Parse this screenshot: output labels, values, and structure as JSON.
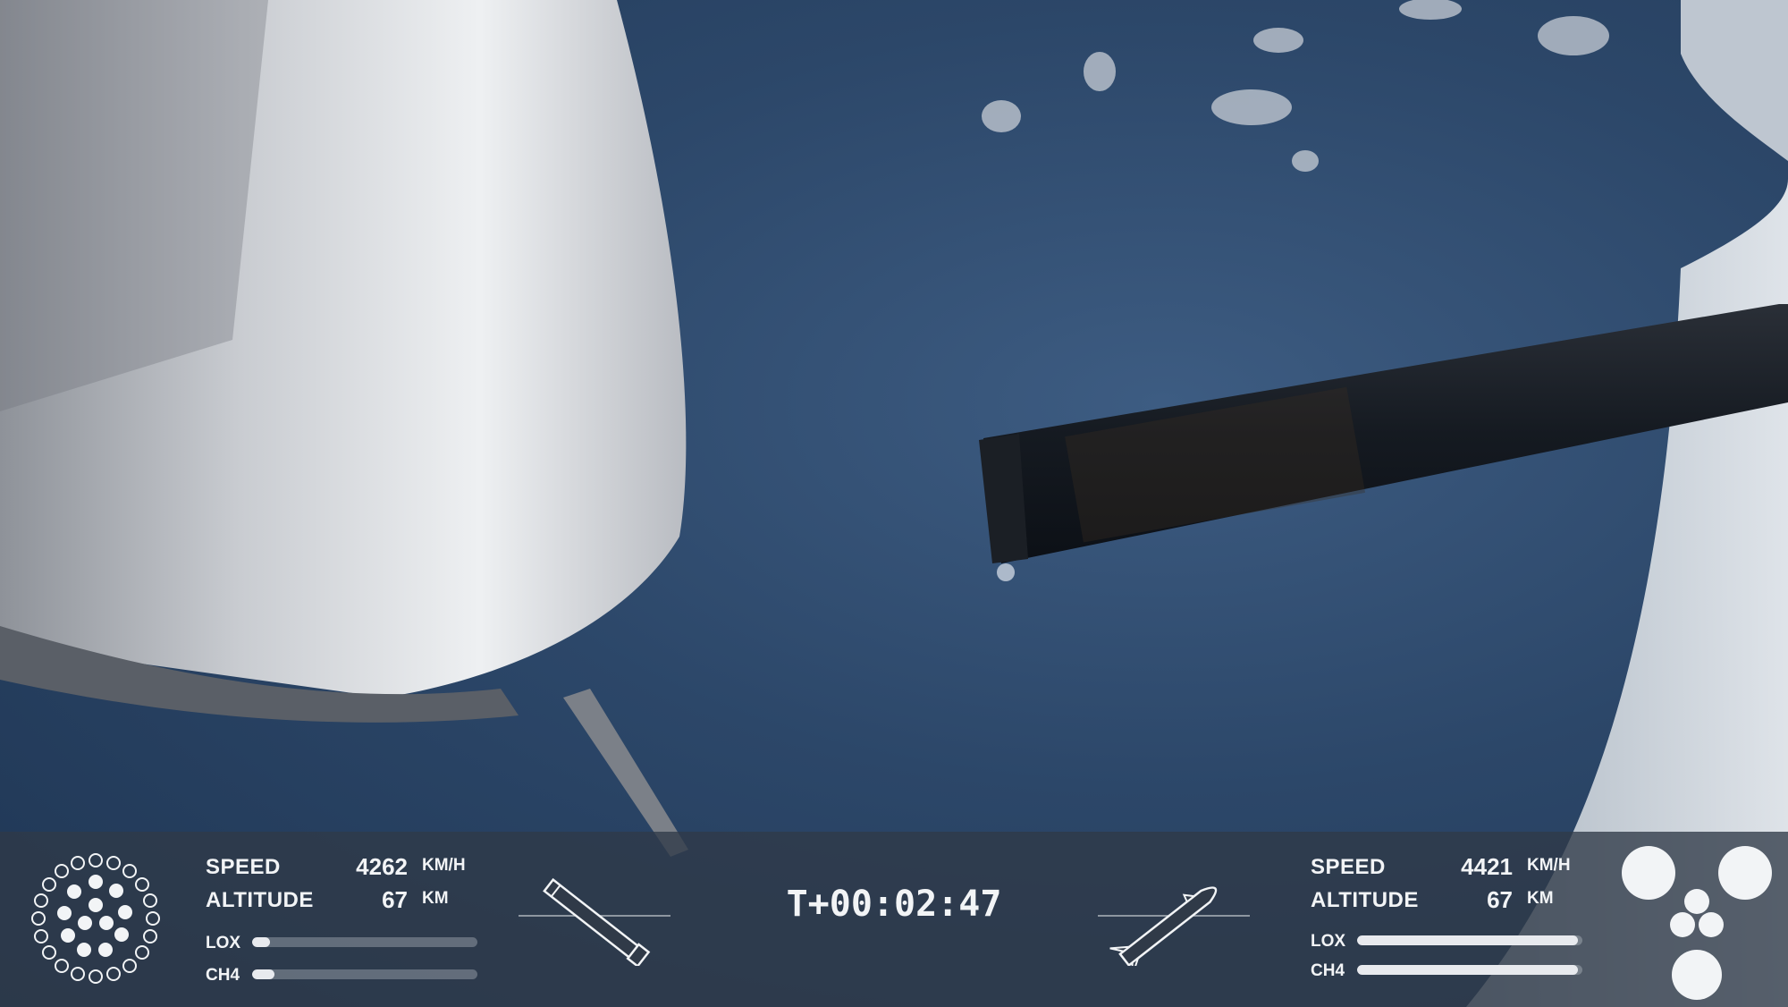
{
  "booster": {
    "speed_label": "SPEED",
    "speed_value": "4262",
    "speed_unit": "KM/H",
    "altitude_label": "ALTITUDE",
    "altitude_value": "67",
    "altitude_unit": "KM",
    "lox_label": "LOX",
    "lox_level": 0.08,
    "ch4_label": "CH4",
    "ch4_level": 0.1
  },
  "mission_clock": "T+00:02:47",
  "ship": {
    "speed_label": "SPEED",
    "speed_value": "4421",
    "speed_unit": "KM/H",
    "altitude_label": "ALTITUDE",
    "altitude_value": "67",
    "altitude_unit": "KM",
    "lox_label": "LOX",
    "lox_level": 0.98,
    "ch4_label": "CH4",
    "ch4_level": 0.98
  },
  "icons": {
    "booster_engines": "booster-engine-cluster-icon",
    "booster_vehicle": "booster-silhouette-icon",
    "ship_vehicle": "ship-silhouette-icon",
    "ship_engines": "ship-engine-cluster-icon"
  },
  "colors": {
    "hud_text": "#f2f4f6",
    "hud_band": "#303a48",
    "sky": "#2c4769"
  }
}
